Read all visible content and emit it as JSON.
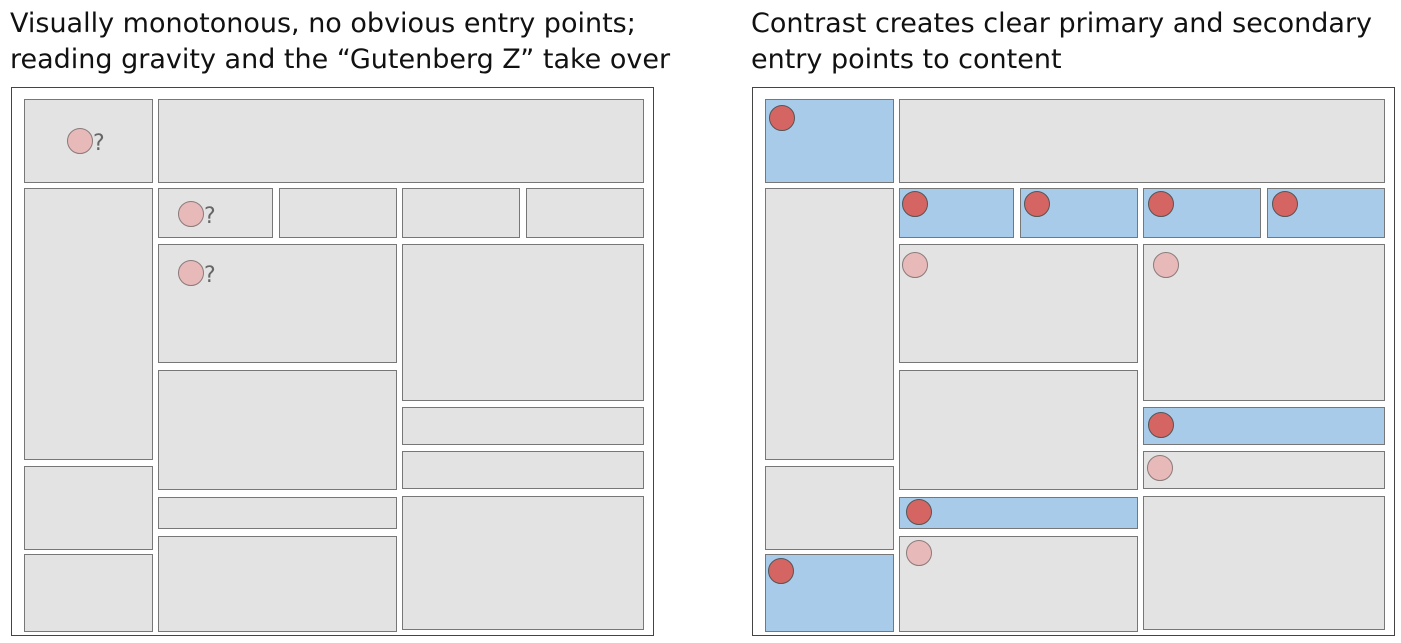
{
  "left_panel": {
    "caption_lines": [
      "Visually monotonous, no obvious entry points;",
      "reading gravity and the “Gutenberg Z” take over"
    ],
    "uncertain_entry_mark": "?"
  },
  "right_panel": {
    "caption_lines": [
      "Contrast creates clear primary and secondary",
      "entry points to content"
    ]
  },
  "colors": {
    "block_gray": "#e3e3e3",
    "highlight_blue": "#a9cbea",
    "primary_dot_red": "#d46563",
    "secondary_dot_pink": "#e8b9b9",
    "frame_border": "#444444"
  }
}
